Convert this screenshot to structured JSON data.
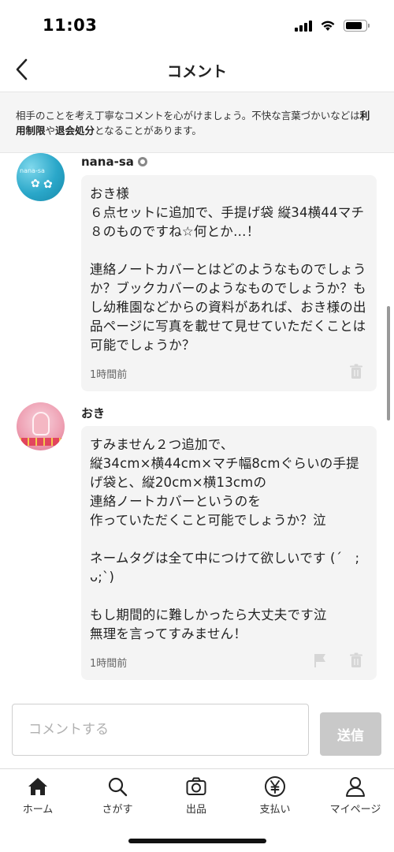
{
  "status_bar": {
    "time": "11:03"
  },
  "header": {
    "title": "コメント"
  },
  "notice": {
    "text_1": "相手のことを考え丁寧なコメントを心がけましょう。不快な言葉づかいなどは",
    "strong_1": "利用制限",
    "text_2": "や",
    "strong_2": "退会処分",
    "text_3": "となることがあります。"
  },
  "comments": [
    {
      "username": "nana-sa",
      "avatar_text": "nana-sa",
      "text": "おき様\n６点セットに追加で、手提げ袋 縦34横44マチ８のものですね☆何とか…！\n\n連絡ノートカバーとはどのようなものでしょうか？ブックカバーのようなものでしょうか？もし幼稚園などからの資料があれば、おき様の出品ページに写真を載せて見せていただくことは可能でしょうか？",
      "time": "1時間前"
    },
    {
      "username": "おき",
      "text": "すみません２つ追加で、\n縦34cm×横44cm×マチ幅8cmぐらいの手提げ袋と、縦20cm×横13cmの\n連絡ノートカバーというのを\n作っていただくこと可能でしょうか？泣\n\nネームタグは全て中につけて欲しいです (´   ;ᴗ;`)\n\nもし期間的に難しかったら大丈夫です泣\n無理を言ってすみません！",
      "time": "1時間前"
    }
  ],
  "input": {
    "placeholder": "コメントする"
  },
  "send_button": {
    "label": "送信"
  },
  "tabs": [
    {
      "label": "ホーム",
      "icon": "home-icon"
    },
    {
      "label": "さがす",
      "icon": "search-icon"
    },
    {
      "label": "出品",
      "icon": "camera-icon"
    },
    {
      "label": "支払い",
      "icon": "yen-icon"
    },
    {
      "label": "マイページ",
      "icon": "person-icon"
    }
  ],
  "colors": {
    "bubble_bg": "#f4f4f4",
    "notice_bg": "#f5f5f5",
    "send_disabled": "#c9c9c9",
    "text": "#222222"
  }
}
